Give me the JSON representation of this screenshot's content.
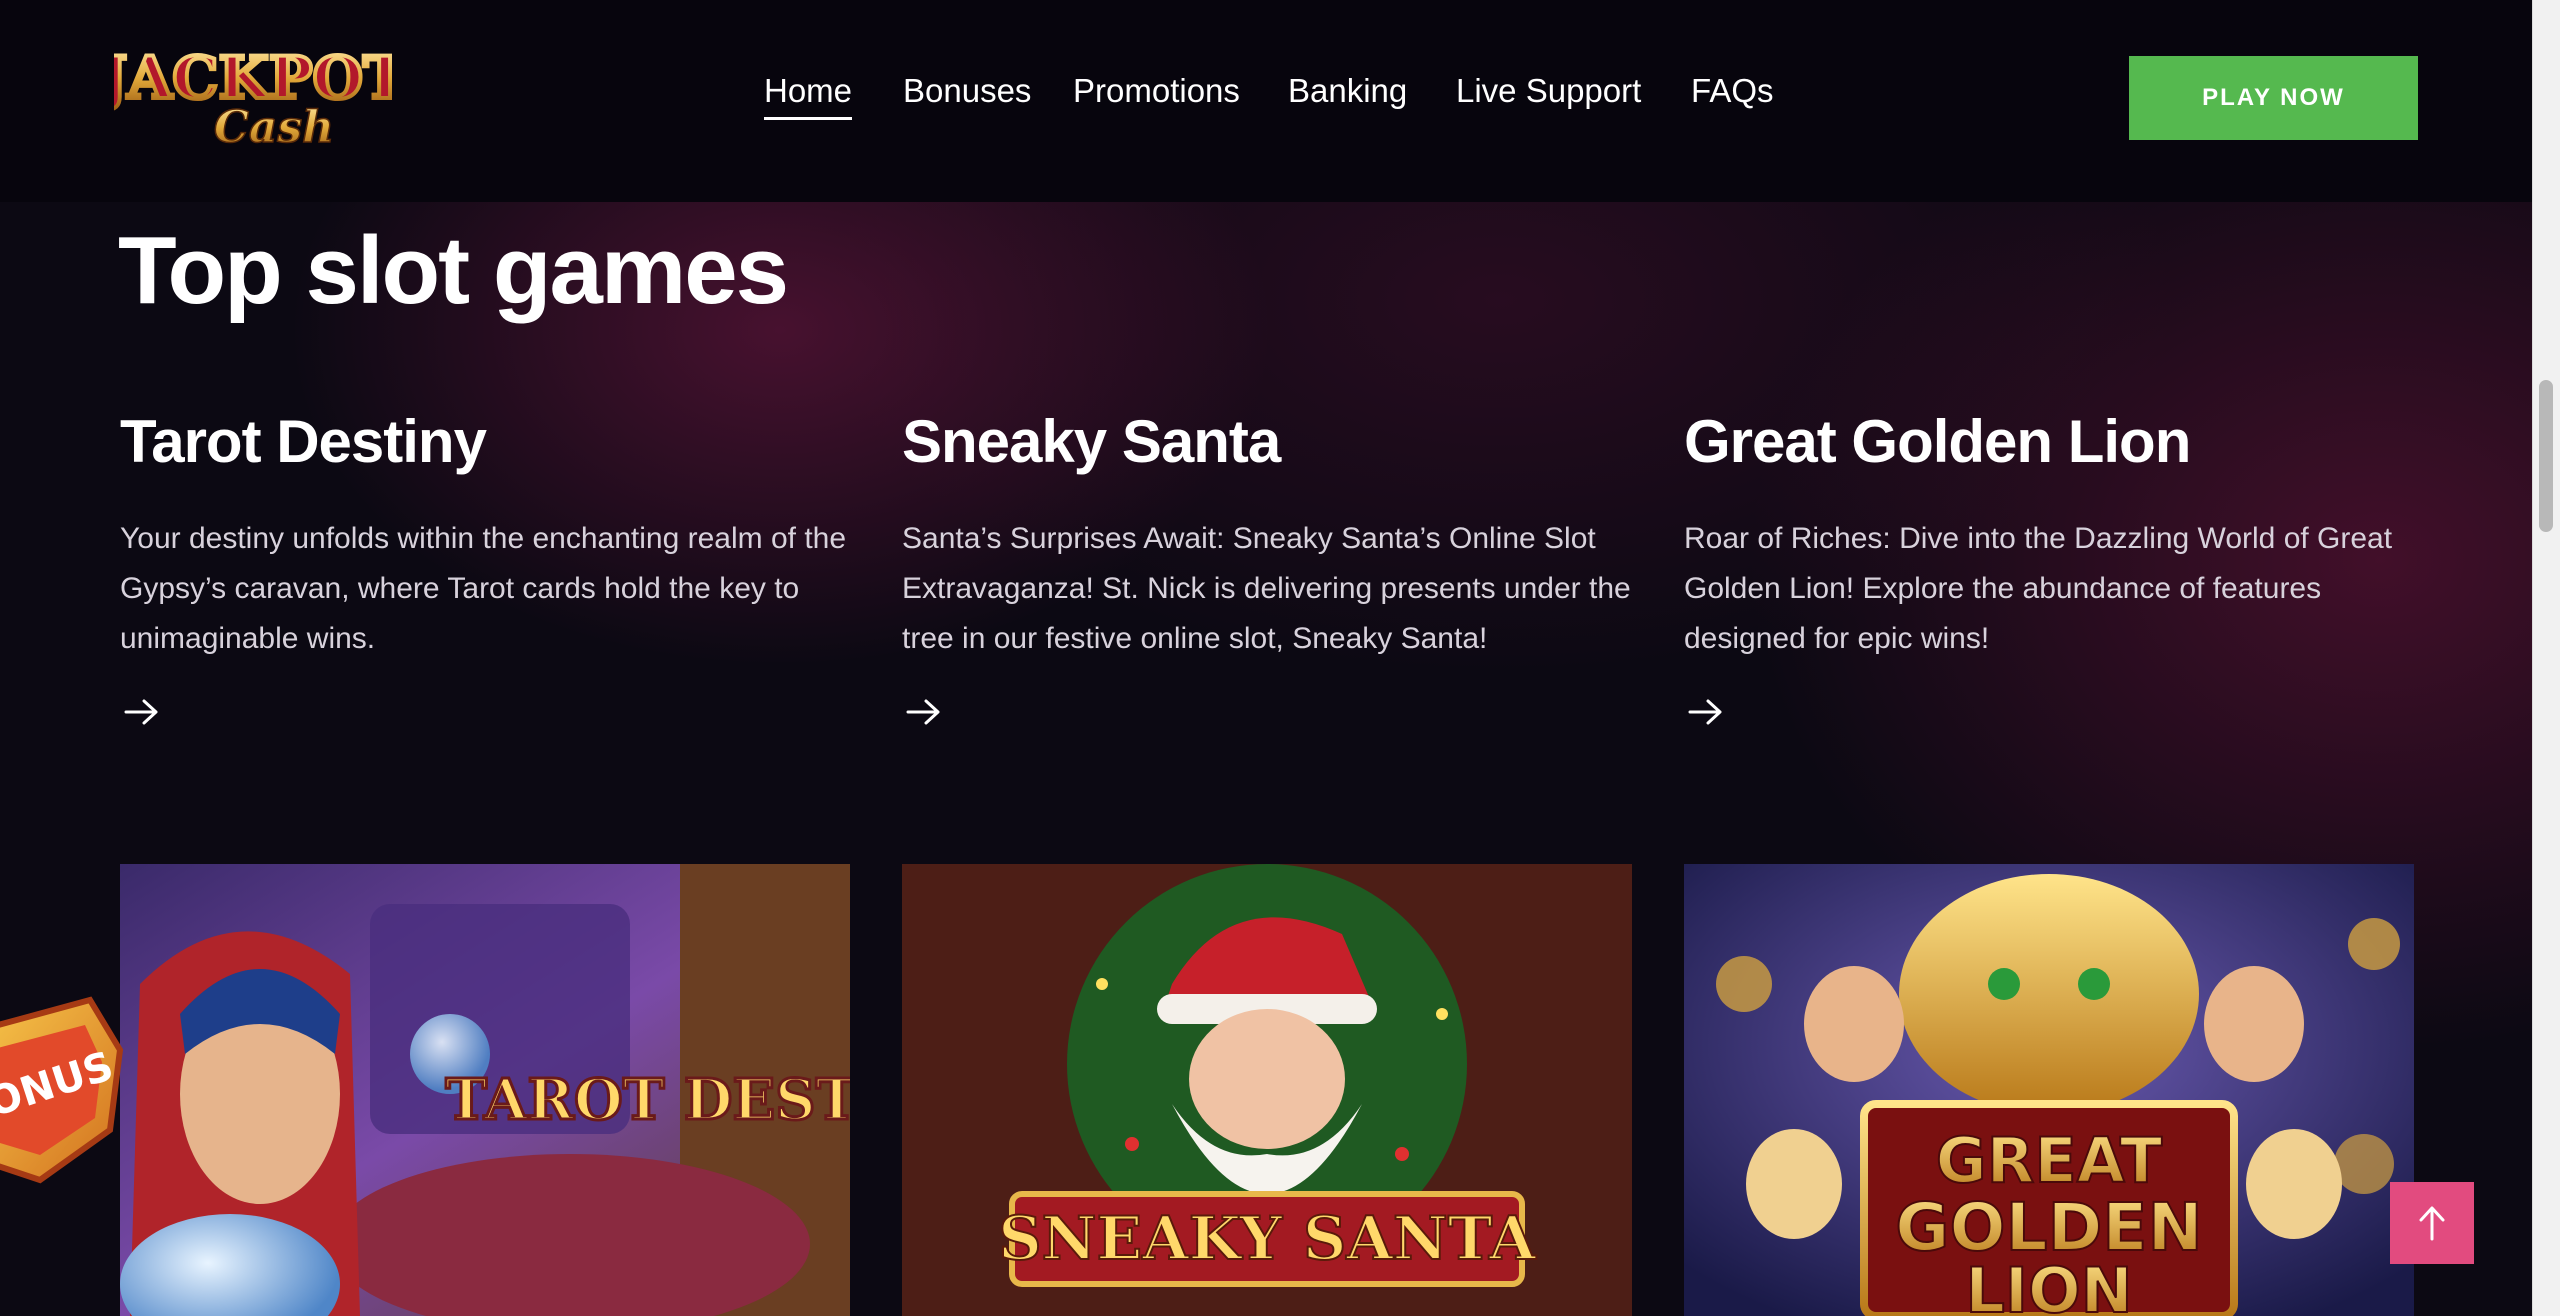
{
  "brand": {
    "logo_line1": "JACKPOT",
    "logo_line2": "Cash"
  },
  "nav": {
    "items": [
      {
        "label": "Home",
        "active": true
      },
      {
        "label": "Bonuses",
        "active": false
      },
      {
        "label": "Promotions",
        "active": false
      },
      {
        "label": "Banking",
        "active": false
      },
      {
        "label": "Live Support",
        "active": false
      },
      {
        "label": "FAQs",
        "active": false
      }
    ],
    "cta_label": "PLAY NOW"
  },
  "section": {
    "title": "Top slot games"
  },
  "games": [
    {
      "title": "Tarot Destiny",
      "description": "Your destiny unfolds within the enchanting realm of the Gypsy’s caravan, where Tarot cards hold the key to unimaginable wins.",
      "banner_text": "TAROT DESTIN",
      "arrow_icon": "arrow-right-icon"
    },
    {
      "title": "Sneaky Santa",
      "description": "Santa’s Surprises Await: Sneaky Santa’s Online Slot Extravaganza! St. Nick is delivering presents under the tree in our festive online slot, Sneaky Santa!",
      "banner_text": "SNEAKY SANTA",
      "arrow_icon": "arrow-right-icon"
    },
    {
      "title": "Great Golden Lion",
      "description": "Roar of Riches: Dive into the Dazzling World of Great Golden Lion! Explore the abundance of features designed for epic wins!",
      "banner_line1": "GREAT",
      "banner_line2": "GOLDEN",
      "banner_line3": "LION",
      "arrow_icon": "arrow-right-icon"
    }
  ],
  "floating": {
    "bonus_text": "BONUS",
    "to_top_icon": "arrow-up-icon"
  },
  "colors": {
    "cta": "#55b94f",
    "to_top": "#e24b7f",
    "background": "#0c0913"
  }
}
